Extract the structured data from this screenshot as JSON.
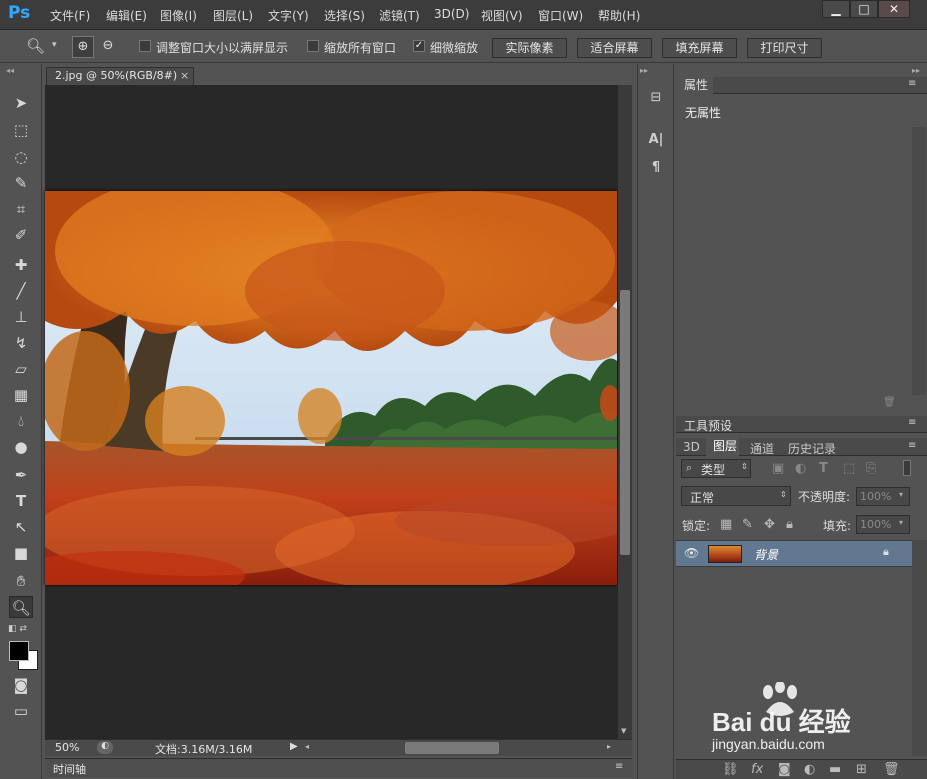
{
  "app": {
    "logo": "Ps"
  },
  "menu": [
    "文件(F)",
    "编辑(E)",
    "图像(I)",
    "图层(L)",
    "文字(Y)",
    "选择(S)",
    "滤镜(T)",
    "3D(D)",
    "视图(V)",
    "窗口(W)",
    "帮助(H)"
  ],
  "options": {
    "checkboxes": [
      {
        "label": "调整窗口大小以满屏显示",
        "checked": false
      },
      {
        "label": "缩放所有窗口",
        "checked": false
      },
      {
        "label": "细微缩放",
        "checked": true
      }
    ],
    "buttons": [
      "实际像素",
      "适合屏幕",
      "填充屏幕",
      "打印尺寸"
    ]
  },
  "document": {
    "tab_title": "2.jpg @ 50%(RGB/8#)",
    "tab_close": "×",
    "zoom": "50%",
    "doc_size": "文档:3.16M/3.16M"
  },
  "panels": {
    "properties": {
      "title": "属性",
      "content": "无属性"
    },
    "tool_presets": {
      "title": "工具预设"
    },
    "layers_tabs": [
      "3D",
      "图层",
      "通道",
      "历史记录"
    ],
    "filter_kind": "类型",
    "blend_mode": "正常",
    "opacity_label": "不透明度:",
    "opacity_value": "100%",
    "lock_label": "锁定:",
    "fill_label": "填充:",
    "fill_value": "100%",
    "layer_name": "背景"
  },
  "timeline": {
    "label": "时间轴"
  },
  "watermark": {
    "brand": "Bai du 经验",
    "url": "jingyan.baidu.com"
  }
}
